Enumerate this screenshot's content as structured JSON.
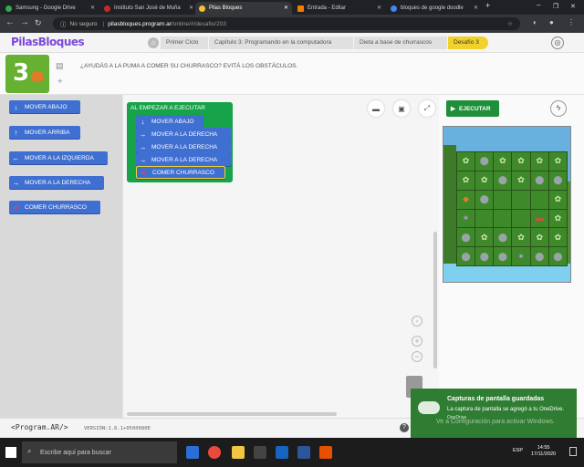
{
  "browser": {
    "tabs": [
      {
        "label": "Samsung - Google Drive",
        "color": "#34a853"
      },
      {
        "label": "Instituto San José de Muña",
        "color": "#c62828"
      },
      {
        "label": "Pilas Bloques",
        "color": "#f2c230",
        "active": true
      },
      {
        "label": "Entrada - Editar",
        "color": "#f57c00"
      },
      {
        "label": "bloques de google doodle",
        "color": "#4285f4"
      }
    ],
    "security": "No seguro",
    "url_host": "pilasbloques.program.ar",
    "url_path": "/online/#/desafio/203"
  },
  "app": {
    "logo": "PilasBloques",
    "breadcrumb": [
      "Primer Ciclo",
      "Capítulo 3: Programando en la computadora",
      "Dieta a base de churrascos",
      "Desafío 3"
    ]
  },
  "challenge": {
    "number": "3",
    "description": "¿AYUDÁS A LA PUMA A COMER SU CHURRASCO? EVITÁ LOS OBSTÁCULOS."
  },
  "toolbox": {
    "blocks": [
      {
        "label": "MOVER ABAJO",
        "icon": "arrow-down-icon"
      },
      {
        "label": "MOVER ARRIBA",
        "icon": "arrow-up-icon"
      },
      {
        "label": "MOVER A LA IZQUIERDA",
        "icon": "arrow-left-icon"
      },
      {
        "label": "MOVER A LA DERECHA",
        "icon": "arrow-right-icon"
      },
      {
        "label": "COMER CHURRASCO",
        "icon": "steak-icon"
      }
    ]
  },
  "workspace": {
    "event_label": "AL EMPEZAR A EJECUTAR",
    "program": [
      {
        "label": "MOVER ABAJO",
        "icon": "arrow-down-icon"
      },
      {
        "label": "MOVER A LA DERECHA",
        "icon": "arrow-right-icon"
      },
      {
        "label": "MOVER A LA DERECHA",
        "icon": "arrow-right-icon"
      },
      {
        "label": "MOVER A LA DERECHA",
        "icon": "arrow-right-icon"
      },
      {
        "label": "COMER CHURRASCO",
        "icon": "steak-icon"
      }
    ]
  },
  "stage": {
    "run_label": "EJECUTAR",
    "grid": [
      [
        "plant",
        "rock",
        "plant",
        "plant",
        "plant",
        "plant"
      ],
      [
        "plant",
        "plant",
        "rock",
        "plant",
        "rock",
        "rock"
      ],
      [
        "puma",
        "rock",
        "empty",
        "empty",
        "empty",
        "plant"
      ],
      [
        "weed",
        "empty",
        "empty",
        "empty",
        "steak",
        "plant"
      ],
      [
        "rock",
        "plant",
        "rock",
        "plant",
        "plant",
        "plant"
      ],
      [
        "rock",
        "rock",
        "rock",
        "weed",
        "rock",
        "rock"
      ]
    ]
  },
  "footer": {
    "logo": "<Program.AR/>",
    "version": "VERSIÓN:1.6.1+0500680E",
    "help": "?"
  },
  "toast": {
    "title": "Capturas de pantalla guardadas",
    "body": "La captura de pantalla se agregó a tu OneDrive.",
    "source": "OneDrive"
  },
  "watermark": "Ve a Configuración para activar Windows.",
  "taskbar": {
    "search_placeholder": "Escribe aquí para buscar",
    "lang": "ESP",
    "time": "14:55",
    "date": "17/11/2020"
  },
  "colors": {
    "block_blue": "#3f6fd0",
    "event_green": "#16a34a",
    "run_green": "#1f8f3a",
    "accent_yellow": "#f2d22a"
  }
}
